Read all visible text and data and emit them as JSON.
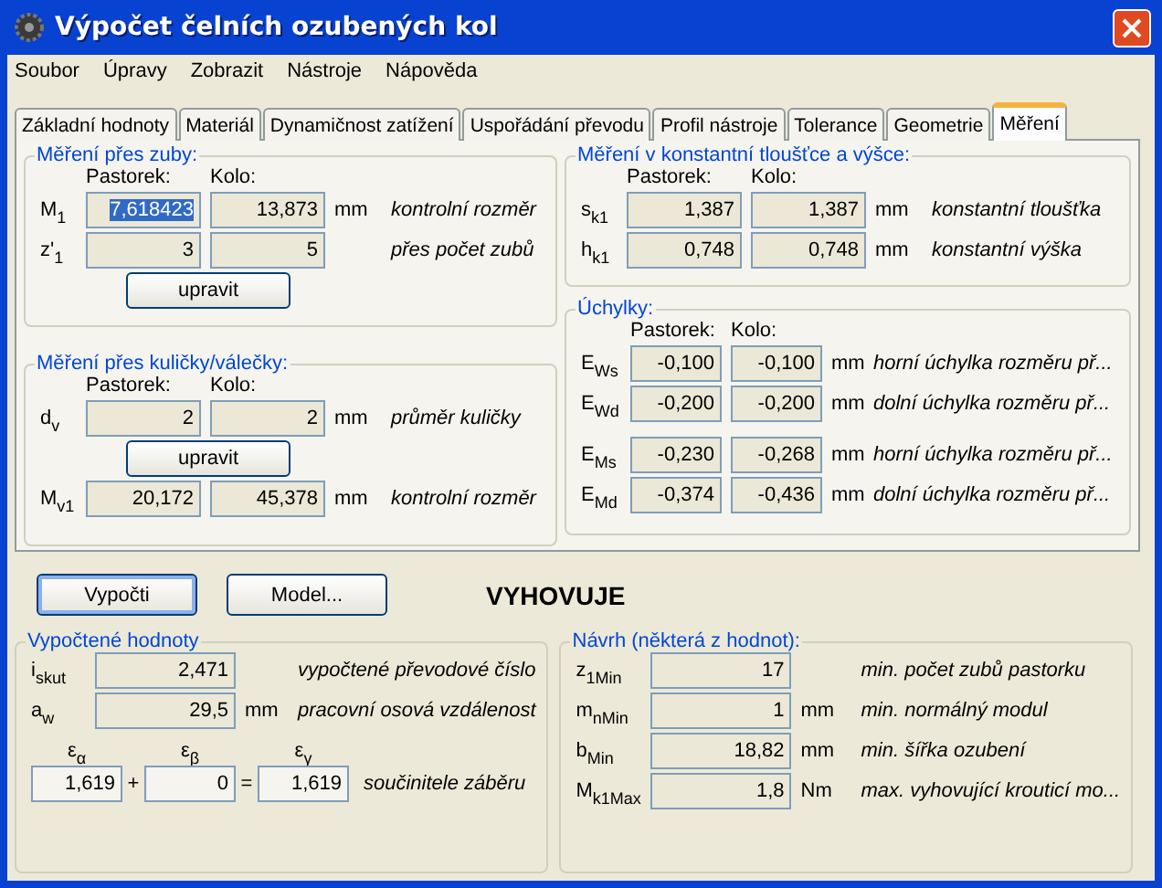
{
  "window": {
    "title": "Výpočet čelních ozubených kol"
  },
  "menu": [
    {
      "label": "Soubor"
    },
    {
      "label": "Úpravy"
    },
    {
      "label": "Zobrazit"
    },
    {
      "label": "Nástroje"
    },
    {
      "label": "Nápověda"
    }
  ],
  "tabs": [
    {
      "label": "Základní hodnoty",
      "selected": false
    },
    {
      "label": "Materiál",
      "selected": false
    },
    {
      "label": "Dynamičnost zatížení",
      "selected": false
    },
    {
      "label": "Uspořádání převodu",
      "selected": false
    },
    {
      "label": "Profil nástroje",
      "selected": false
    },
    {
      "label": "Tolerance",
      "selected": false
    },
    {
      "label": "Geometrie",
      "selected": false
    },
    {
      "label": "Měření",
      "selected": true
    }
  ],
  "teeth": {
    "title": "Měření přes zuby:",
    "headers": [
      "Pastorek:",
      "Kolo:"
    ],
    "button": "upravit",
    "rows": [
      {
        "symbol": "M$_{1}$",
        "values": [
          {
            "text": "7,618423",
            "selected": true
          },
          {
            "text": "13,873",
            "selected": false
          }
        ],
        "unit": "mm",
        "description": "kontrolní rozměr"
      },
      {
        "symbol": "z'$_{1}$",
        "values": [
          {
            "text": "3",
            "selected": false
          },
          {
            "text": "5",
            "selected": false
          }
        ],
        "description": "přes počet zubů"
      }
    ]
  },
  "balls": {
    "title": "Měření přes kuličky/válečky:",
    "headers": [
      "Pastorek:",
      "Kolo:"
    ],
    "button": "upravit",
    "rows": [
      {
        "symbol": "d$_{v}$",
        "values": [
          {
            "text": "2",
            "selected": false
          },
          {
            "text": "2",
            "selected": false
          }
        ],
        "unit": "mm",
        "description": "průměr kuličky"
      }
    ],
    "result_rows": [
      {
        "symbol": "M$_{v1}$",
        "values": [
          {
            "text": "20,172",
            "selected": false
          },
          {
            "text": "45,378",
            "selected": false
          }
        ],
        "unit": "mm",
        "description": "kontrolní rozměr"
      }
    ]
  },
  "constant": {
    "title": "Měření v konstantní tloušťce a výšce:",
    "headers": [
      "Pastorek:",
      "Kolo:"
    ],
    "rows": [
      {
        "symbol": "s$_{k1}$",
        "values": [
          {
            "text": "1,387",
            "selected": false
          },
          {
            "text": "1,387",
            "selected": false
          }
        ],
        "unit": "mm",
        "description": "konstantní tloušťka"
      },
      {
        "symbol": "h$_{k1}$",
        "values": [
          {
            "text": "0,748",
            "selected": false
          },
          {
            "text": "0,748",
            "selected": false
          }
        ],
        "unit": "mm",
        "description": "konstantní výška"
      }
    ]
  },
  "deviations": {
    "title": "Úchylky:",
    "headers": [
      "Pastorek:",
      "Kolo:"
    ],
    "rows": [
      {
        "symbol": "E$_{Ws}$",
        "values": [
          {
            "text": "-0,100",
            "selected": false
          },
          {
            "text": "-0,100",
            "selected": false
          }
        ],
        "unit": "mm",
        "description": "horní úchylka rozměru př..."
      },
      {
        "symbol": "E$_{Wd}$",
        "values": [
          {
            "text": "-0,200",
            "selected": false
          },
          {
            "text": "-0,200",
            "selected": false
          }
        ],
        "unit": "mm",
        "description": "dolní úchylka rozměru př..."
      }
    ],
    "rows_2": [
      {
        "symbol": "E$_{Ms}$",
        "values": [
          {
            "text": "-0,230",
            "selected": false
          },
          {
            "text": "-0,268",
            "selected": false
          }
        ],
        "unit": "mm",
        "description": "horní úchylka rozměru př..."
      },
      {
        "symbol": "E$_{Md}$",
        "values": [
          {
            "text": "-0,374",
            "selected": false
          },
          {
            "text": "-0,436",
            "selected": false
          }
        ],
        "unit": "mm",
        "description": "dolní úchylka rozměru př..."
      }
    ]
  },
  "actions": [
    {
      "label": "Vypočti",
      "default": true
    },
    {
      "label": "Model...",
      "default": false
    }
  ],
  "verdict": "VYHOVUJE",
  "computed": {
    "title": "Vypočtené hodnoty",
    "rows": [
      {
        "symbol": "i$_{skut}$",
        "value": "2,471",
        "description": "vypočtené převodové číslo"
      },
      {
        "symbol": "a$_{w}$",
        "value": "29,5",
        "unit": "mm",
        "description": "pracovní osová vzdálenost"
      }
    ],
    "contact": {
      "symbols": [
        "ε$_{α}$",
        "ε$_{β}$",
        "ε$_{γ}$"
      ],
      "values": [
        "1,619",
        "0",
        "1,619"
      ],
      "operators": [
        "+",
        "="
      ],
      "description": "součinitele záběru"
    }
  },
  "design": {
    "title": "Návrh (některá z hodnot):",
    "rows": [
      {
        "symbol": "z$_{1Min}$",
        "value": "17",
        "description": "min. počet zubů pastorku"
      },
      {
        "symbol": "m$_{nMin}$",
        "value": "1",
        "unit": "mm",
        "description": "min. normálný modul"
      },
      {
        "symbol": "b$_{Min}$",
        "value": "18,82",
        "unit": "mm",
        "description": "min. šířka ozubení"
      },
      {
        "symbol": "M$_{k1Max}$",
        "value": "1,8",
        "unit": "Nm",
        "description": "max. vyhovující krouticí mo..."
      }
    ]
  }
}
